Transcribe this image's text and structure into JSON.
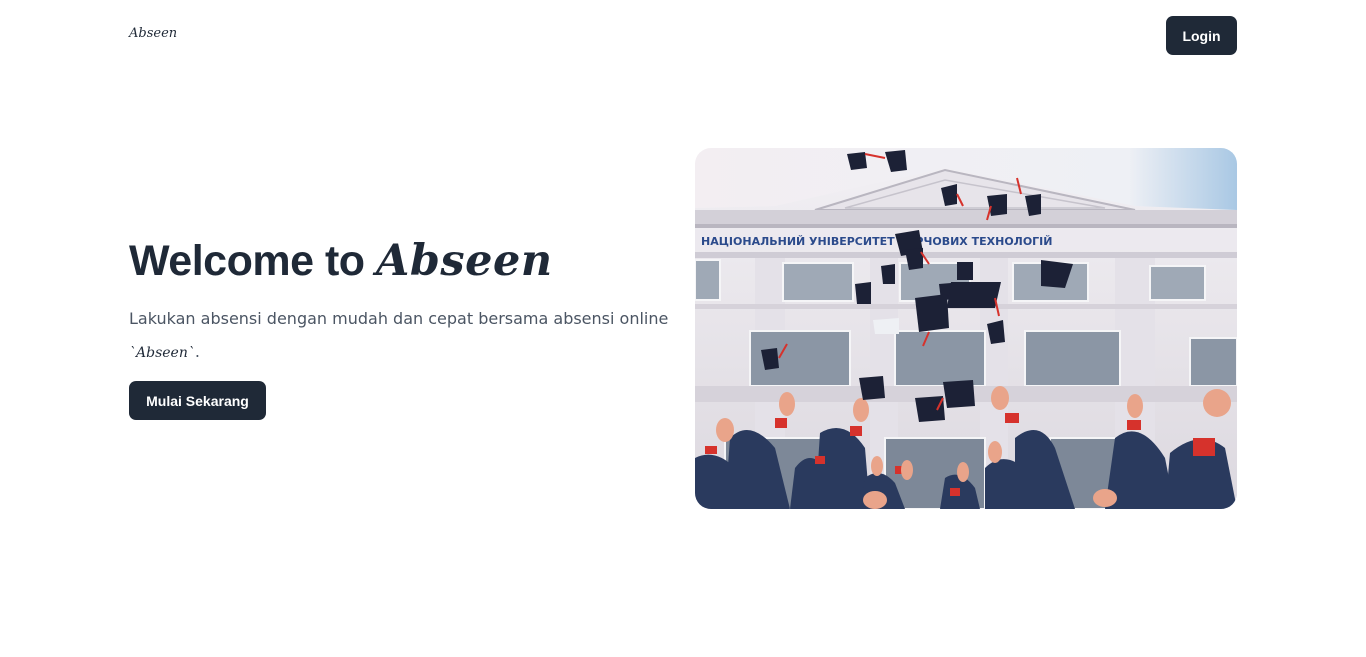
{
  "navbar": {
    "brand": "Abseen",
    "login_label": "Login"
  },
  "hero": {
    "title_prefix": "Welcome to ",
    "title_brand": "Abseen",
    "description_text": "Lakukan absensi dengan mudah dan cepat bersama absensi online ",
    "description_brand": "`Abseen`",
    "description_suffix": ".",
    "cta_label": "Mulai Sekarang",
    "image_sign": "НАЦІОНАЛЬНИЙ УНІВЕРСИТЕТ ХАРЧОВИХ ТЕХНОЛОГІЙ"
  },
  "colors": {
    "primary_dark": "#1f2937",
    "text_muted": "#4b5563",
    "background": "#ffffff"
  }
}
